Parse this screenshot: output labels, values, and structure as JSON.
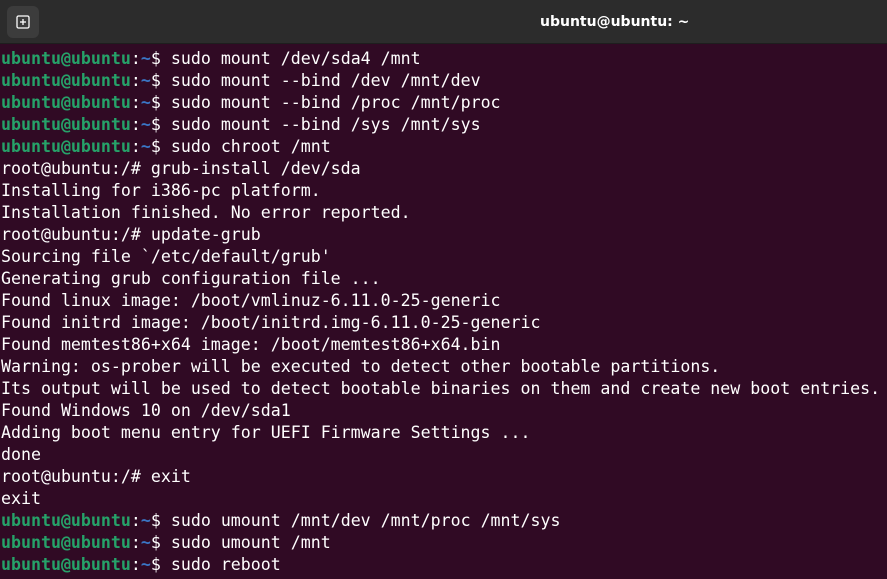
{
  "window": {
    "title": "ubuntu@ubuntu: ~"
  },
  "terminal": {
    "lines": [
      {
        "type": "prompt",
        "user": "ubuntu@ubuntu",
        "path": "~",
        "symbol": "$",
        "cmd": " sudo mount /dev/sda4 /mnt"
      },
      {
        "type": "prompt",
        "user": "ubuntu@ubuntu",
        "path": "~",
        "symbol": "$",
        "cmd": " sudo mount --bind /dev /mnt/dev"
      },
      {
        "type": "prompt",
        "user": "ubuntu@ubuntu",
        "path": "~",
        "symbol": "$",
        "cmd": " sudo mount --bind /proc /mnt/proc"
      },
      {
        "type": "prompt",
        "user": "ubuntu@ubuntu",
        "path": "~",
        "symbol": "$",
        "cmd": " sudo mount --bind /sys /mnt/sys"
      },
      {
        "type": "prompt",
        "user": "ubuntu@ubuntu",
        "path": "~",
        "symbol": "$",
        "cmd": " sudo chroot /mnt"
      },
      {
        "type": "text",
        "text": "root@ubuntu:/# grub-install /dev/sda"
      },
      {
        "type": "text",
        "text": "Installing for i386-pc platform."
      },
      {
        "type": "text",
        "text": "Installation finished. No error reported."
      },
      {
        "type": "text",
        "text": "root@ubuntu:/# update-grub"
      },
      {
        "type": "text",
        "text": "Sourcing file `/etc/default/grub'"
      },
      {
        "type": "text",
        "text": "Generating grub configuration file ..."
      },
      {
        "type": "text",
        "text": "Found linux image: /boot/vmlinuz-6.11.0-25-generic"
      },
      {
        "type": "text",
        "text": "Found initrd image: /boot/initrd.img-6.11.0-25-generic"
      },
      {
        "type": "text",
        "text": "Found memtest86+x64 image: /boot/memtest86+x64.bin"
      },
      {
        "type": "text",
        "text": "Warning: os-prober will be executed to detect other bootable partitions."
      },
      {
        "type": "text",
        "text": "Its output will be used to detect bootable binaries on them and create new boot entries."
      },
      {
        "type": "text",
        "text": "Found Windows 10 on /dev/sda1"
      },
      {
        "type": "text",
        "text": "Adding boot menu entry for UEFI Firmware Settings ..."
      },
      {
        "type": "text",
        "text": "done"
      },
      {
        "type": "text",
        "text": "root@ubuntu:/# exit"
      },
      {
        "type": "text",
        "text": "exit"
      },
      {
        "type": "prompt",
        "user": "ubuntu@ubuntu",
        "path": "~",
        "symbol": "$",
        "cmd": " sudo umount /mnt/dev /mnt/proc /mnt/sys"
      },
      {
        "type": "prompt",
        "user": "ubuntu@ubuntu",
        "path": "~",
        "symbol": "$",
        "cmd": " sudo umount /mnt"
      },
      {
        "type": "prompt",
        "user": "ubuntu@ubuntu",
        "path": "~",
        "symbol": "$",
        "cmd": " sudo reboot"
      }
    ]
  },
  "colors": {
    "background": "#300a24",
    "titlebar": "#2c2c2c",
    "prompt_user": "#26a269",
    "prompt_path": "#3a75c4",
    "text": "#ffffff"
  },
  "icons": {
    "new_tab": "new-tab-icon"
  }
}
